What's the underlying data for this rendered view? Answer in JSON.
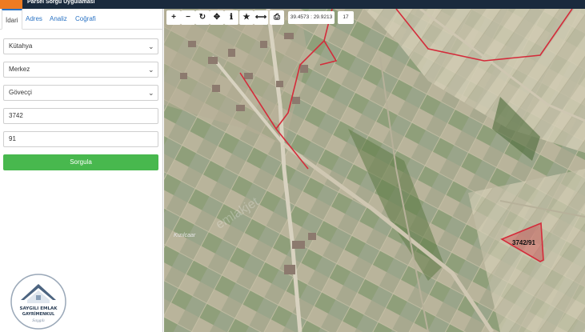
{
  "header": {
    "title": "Parsel Sorgu Uygulaması"
  },
  "tabs": [
    {
      "label": "İdari",
      "active": true
    },
    {
      "label": "Adres"
    },
    {
      "label": "Analiz"
    },
    {
      "label": "Coğrafi"
    }
  ],
  "form": {
    "il": "Kütahya",
    "ilce": "Merkez",
    "mahalle": "Gövecçi",
    "ada": "3742",
    "parsel": "91",
    "submit_label": "Sorgula"
  },
  "toolbar": {
    "coordinates": "39.4573 : 29.9213",
    "zoom": "17"
  },
  "map": {
    "parcel_label": "3742/91",
    "place_label": "Kızılcaar",
    "watermark": "emlakjet"
  },
  "logo": {
    "line1": "SAYGILI EMLAK",
    "line2": "GAYRİMENKUL",
    "signature": "Saygılı"
  },
  "colors": {
    "accent": "#ee7b22",
    "header": "#1a2a3d",
    "submit": "#48b84e",
    "parcel": "#d42b3a"
  }
}
